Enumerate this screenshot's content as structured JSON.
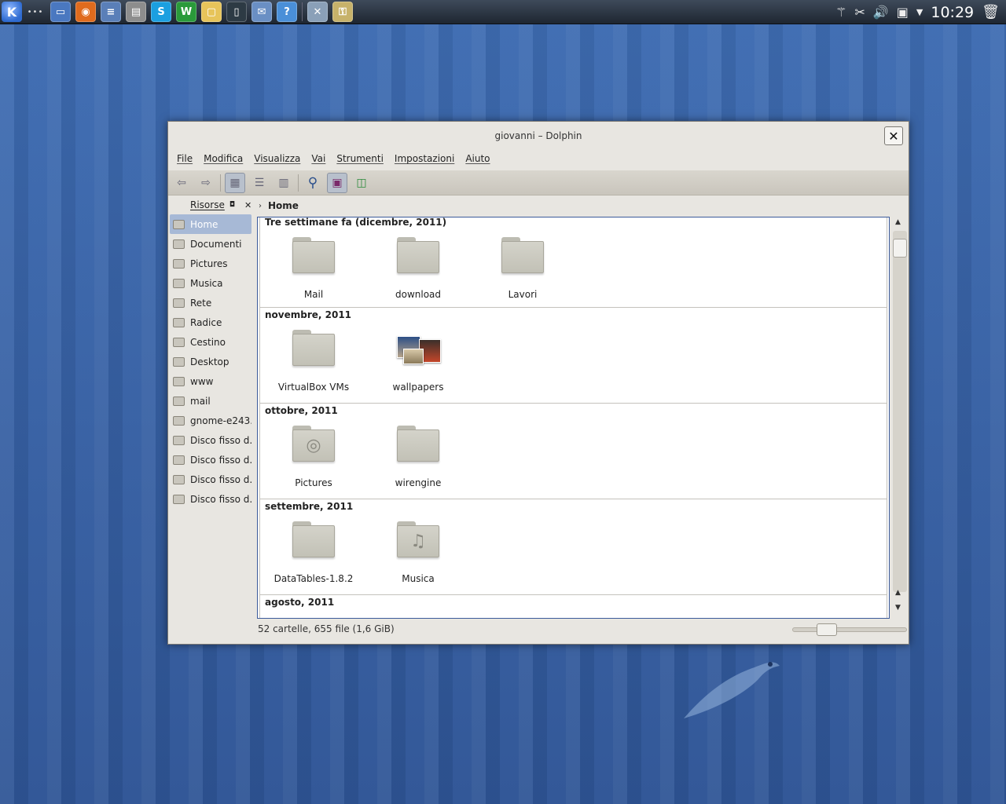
{
  "panel": {
    "launchers": [
      {
        "icon": "desktop-icon",
        "glyph": "▭"
      },
      {
        "icon": "firefox-icon",
        "glyph": "◉"
      },
      {
        "icon": "document-icon",
        "glyph": "≡"
      },
      {
        "icon": "presentation-icon",
        "glyph": "▤"
      },
      {
        "icon": "skype-icon",
        "glyph": "S"
      },
      {
        "icon": "spreadsheet-icon",
        "glyph": "W"
      },
      {
        "icon": "folder-icon",
        "glyph": "▢"
      },
      {
        "icon": "terminal-icon",
        "glyph": "▯"
      },
      {
        "icon": "mail-icon",
        "glyph": "✉"
      },
      {
        "icon": "help-icon",
        "glyph": "?"
      },
      {
        "icon": "tools-icon",
        "glyph": "✕"
      },
      {
        "icon": "key-icon",
        "glyph": "⚿"
      }
    ],
    "clock": "10:29"
  },
  "window": {
    "title": "giovanni – Dolphin",
    "menu": [
      "File",
      "Modifica",
      "Visualizza",
      "Vai",
      "Strumenti",
      "Impostazioni",
      "Aiuto"
    ]
  },
  "sidebar": {
    "title": "Risorse",
    "items": [
      {
        "label": "Home",
        "selected": true
      },
      {
        "label": "Documenti"
      },
      {
        "label": "Pictures"
      },
      {
        "label": "Musica"
      },
      {
        "label": "Rete"
      },
      {
        "label": "Radice"
      },
      {
        "label": "Cestino"
      },
      {
        "label": "Desktop"
      },
      {
        "label": "www"
      },
      {
        "label": "mail"
      },
      {
        "label": "gnome-e243..."
      },
      {
        "label": "Disco fisso d..."
      },
      {
        "label": "Disco fisso d..."
      },
      {
        "label": "Disco fisso d..."
      },
      {
        "label": "Disco fisso d..."
      }
    ]
  },
  "breadcrumb": {
    "current": "Home"
  },
  "groups": [
    {
      "header": "Tre settimane fa (dicembre, 2011)",
      "items": [
        {
          "name": "Mail",
          "type": "folder"
        },
        {
          "name": "download",
          "type": "folder"
        },
        {
          "name": "Lavori",
          "type": "folder"
        }
      ]
    },
    {
      "header": "novembre, 2011",
      "items": [
        {
          "name": "VirtualBox VMs",
          "type": "folder"
        },
        {
          "name": "wallpapers",
          "type": "wallpapers"
        }
      ]
    },
    {
      "header": "ottobre, 2011",
      "items": [
        {
          "name": "Pictures",
          "type": "pictures"
        },
        {
          "name": "wirengine",
          "type": "folder"
        }
      ]
    },
    {
      "header": "settembre, 2011",
      "items": [
        {
          "name": "DataTables-1.8.2",
          "type": "folder"
        },
        {
          "name": "Musica",
          "type": "music"
        }
      ]
    },
    {
      "header": "agosto, 2011",
      "items": []
    }
  ],
  "status": "52 cartelle, 655 file (1,6 GiB)"
}
